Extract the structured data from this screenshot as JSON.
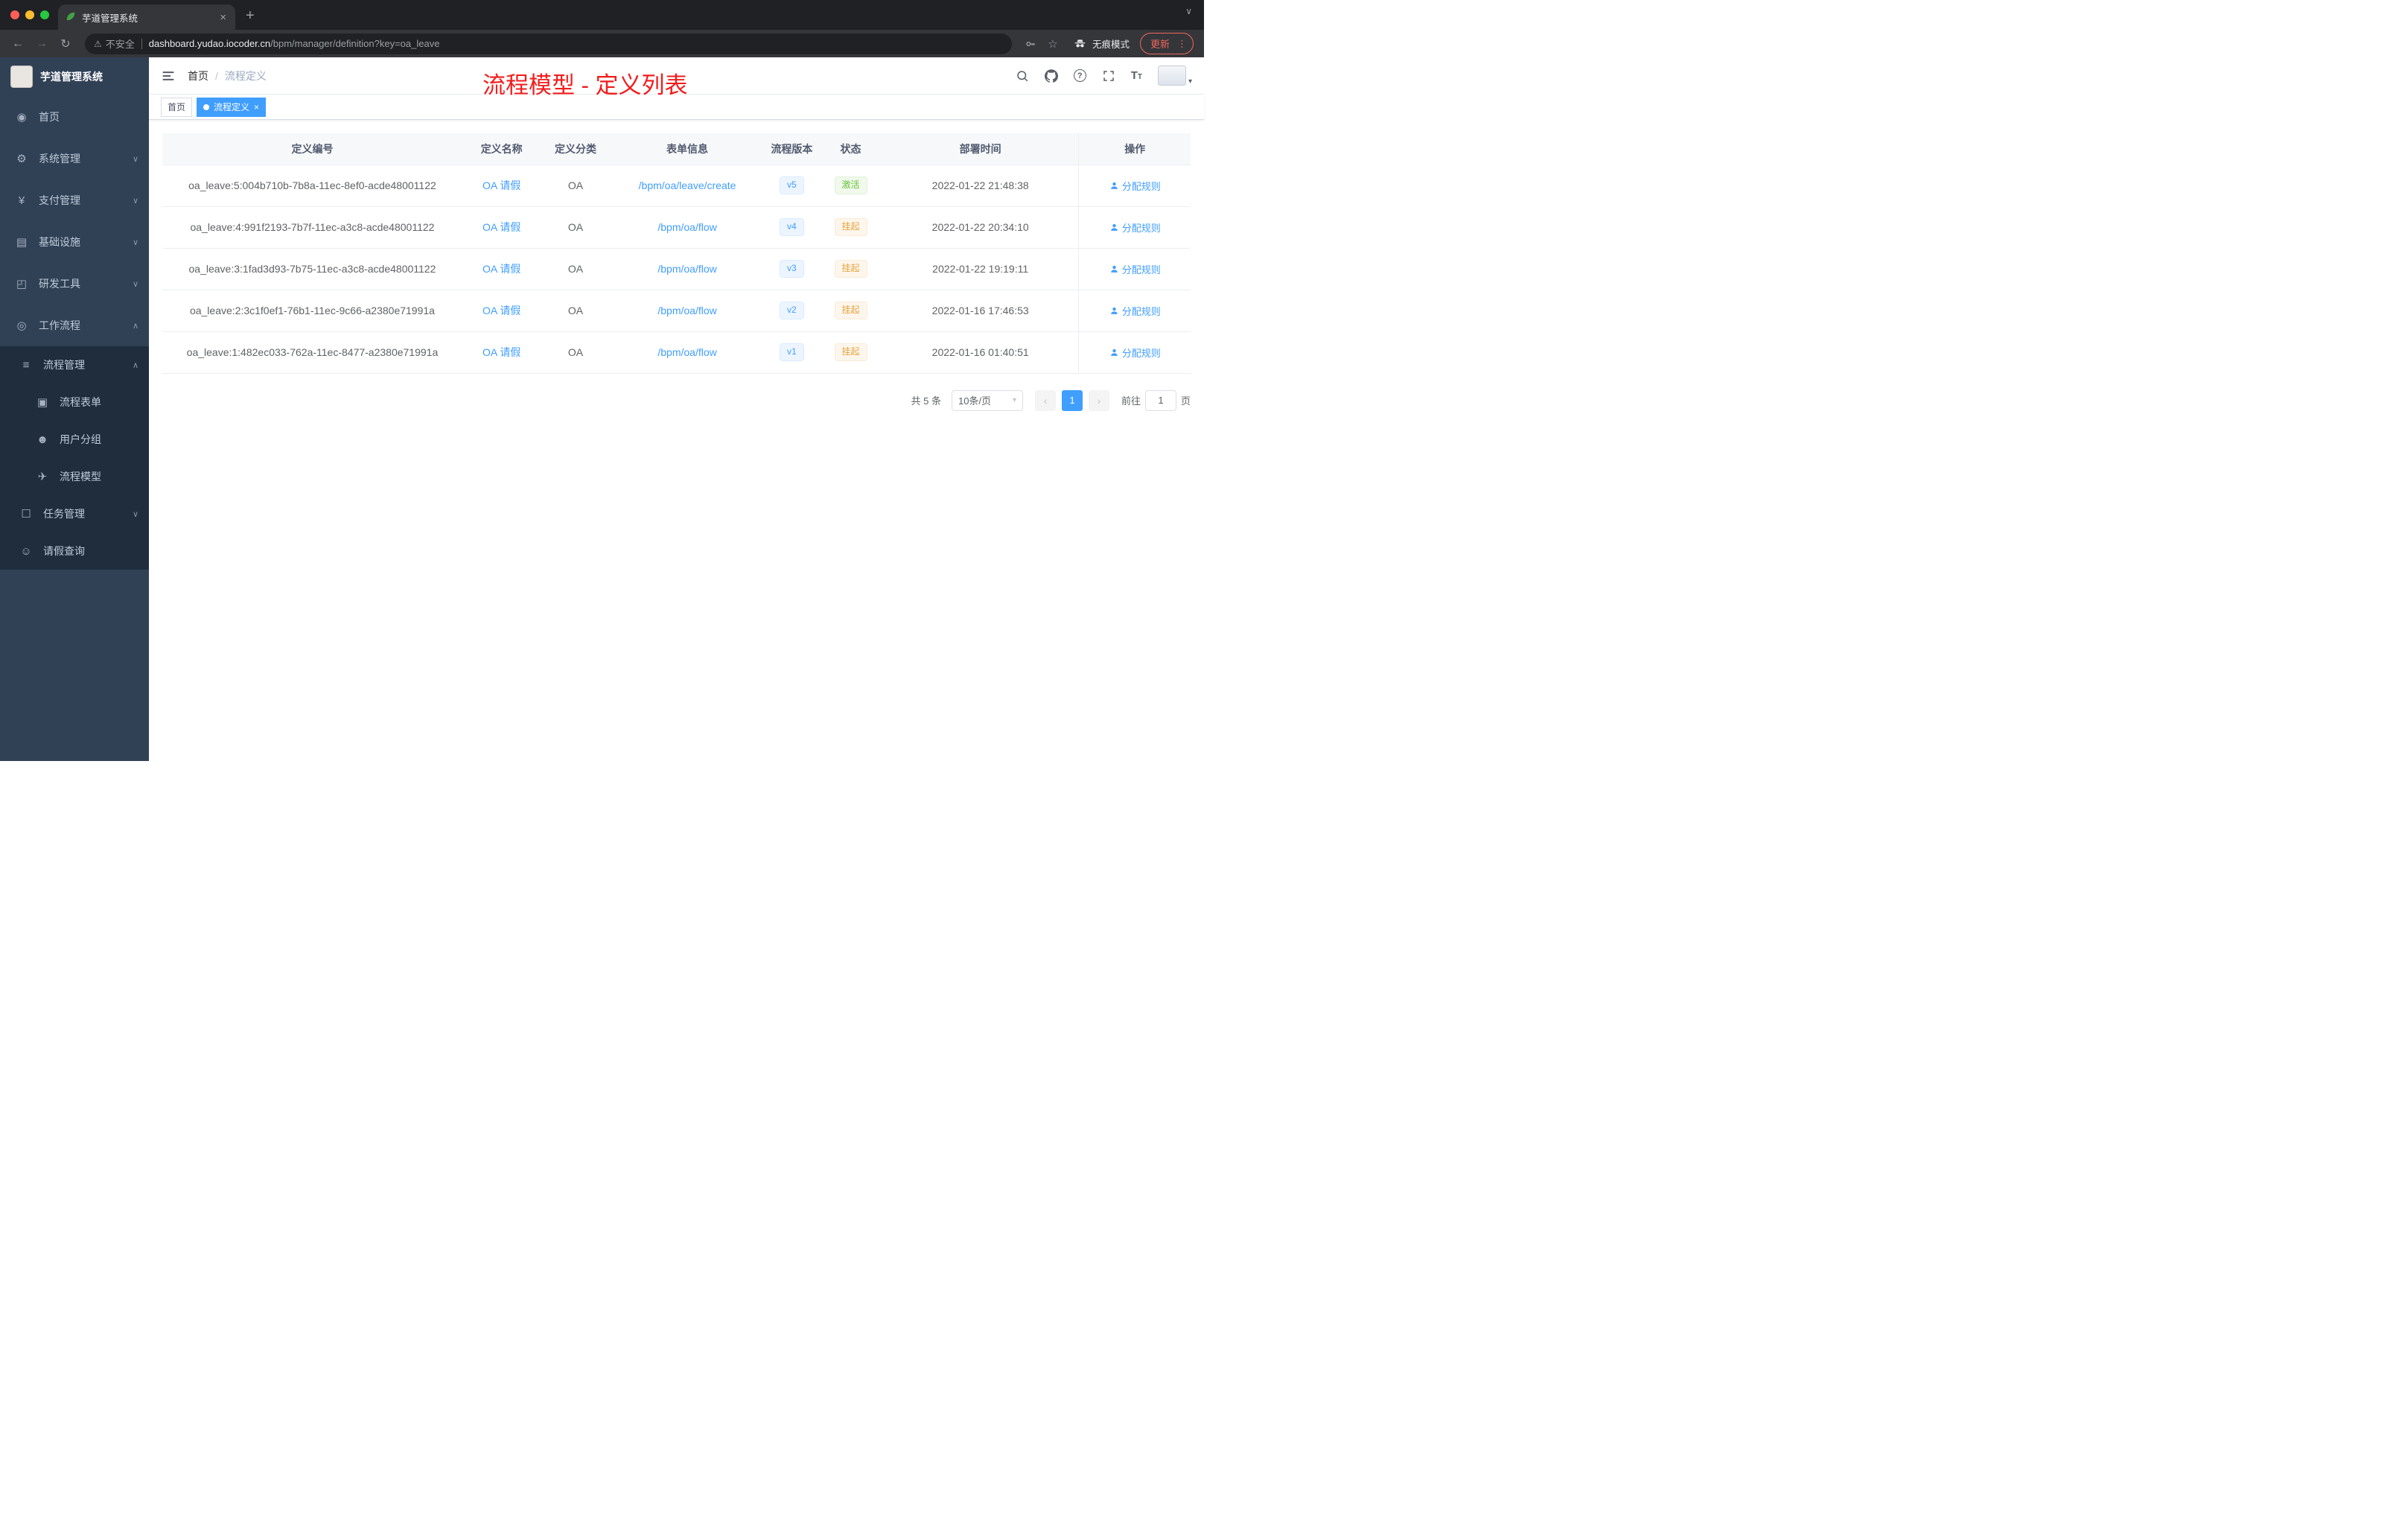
{
  "colors": {
    "accent": "#409eff",
    "annotation_red": "#f21c1c",
    "success": "#67c23a",
    "warning": "#e6a23c",
    "sidebar_bg": "#304156",
    "submenu_bg": "#1f2d3d"
  },
  "icons": {
    "back": "←",
    "forward": "→",
    "reload": "↻",
    "warning": "⚠",
    "star": "☆",
    "more": "⋮",
    "new_tab": "+",
    "close": "×",
    "chevron_down": "∨",
    "chevron_up": "∧",
    "caret_down": "▾",
    "prev": "‹",
    "next": "›",
    "help": "?",
    "t_large": "T",
    "t_small": "T"
  },
  "browser": {
    "tab_title": "芋道管理系统",
    "security": "不安全",
    "url_host": "dashboard.yudao.iocoder.cn",
    "url_path": "/bpm/manager/definition?key=oa_leave",
    "incognito": "无痕模式",
    "update": "更新"
  },
  "sidebar": {
    "title": "芋道管理系统",
    "items": [
      {
        "label": "首页",
        "glyph": "◉"
      },
      {
        "label": "系统管理",
        "glyph": "⚙"
      },
      {
        "label": "支付管理",
        "glyph": "¥"
      },
      {
        "label": "基础设施",
        "glyph": "▤"
      },
      {
        "label": "研发工具",
        "glyph": "◰"
      },
      {
        "label": "工作流程",
        "glyph": "◎"
      }
    ],
    "sub": {
      "process": {
        "label": "流程管理",
        "glyph": "≡"
      },
      "children": [
        {
          "label": "流程表单",
          "glyph": "▣"
        },
        {
          "label": "用户分组",
          "glyph": "☻"
        },
        {
          "label": "流程模型",
          "glyph": "✈"
        }
      ],
      "task": {
        "label": "任务管理",
        "glyph": "☐"
      },
      "leave": {
        "label": "请假查询",
        "glyph": "☺"
      }
    }
  },
  "topbar": {
    "breadcrumb": {
      "home": "首页",
      "sep": "/",
      "current": "流程定义"
    },
    "annotation": "流程模型 - 定义列表"
  },
  "tags": {
    "home": "首页",
    "active": "流程定义"
  },
  "table": {
    "headers": [
      "定义编号",
      "定义名称",
      "定义分类",
      "表单信息",
      "流程版本",
      "状态",
      "部署时间",
      "操作"
    ],
    "rows": [
      {
        "id": "oa_leave:5:004b710b-7b8a-11ec-8ef0-acde48001122",
        "name": "OA 请假",
        "category": "OA",
        "form": "/bpm/oa/leave/create",
        "version": "v5",
        "status": "激活",
        "time": "2022-01-22 21:48:38",
        "action": "分配规则"
      },
      {
        "id": "oa_leave:4:991f2193-7b7f-11ec-a3c8-acde48001122",
        "name": "OA 请假",
        "category": "OA",
        "form": "/bpm/oa/flow",
        "version": "v4",
        "status": "挂起",
        "time": "2022-01-22 20:34:10",
        "action": "分配规则"
      },
      {
        "id": "oa_leave:3:1fad3d93-7b75-11ec-a3c8-acde48001122",
        "name": "OA 请假",
        "category": "OA",
        "form": "/bpm/oa/flow",
        "version": "v3",
        "status": "挂起",
        "time": "2022-01-22 19:19:11",
        "action": "分配规则"
      },
      {
        "id": "oa_leave:2:3c1f0ef1-76b1-11ec-9c66-a2380e71991a",
        "name": "OA 请假",
        "category": "OA",
        "form": "/bpm/oa/flow",
        "version": "v2",
        "status": "挂起",
        "time": "2022-01-16 17:46:53",
        "action": "分配规则"
      },
      {
        "id": "oa_leave:1:482ec033-762a-11ec-8477-a2380e71991a",
        "name": "OA 请假",
        "category": "OA",
        "form": "/bpm/oa/flow",
        "version": "v1",
        "status": "挂起",
        "time": "2022-01-16 01:40:51",
        "action": "分配规则"
      }
    ]
  },
  "pagination": {
    "total": "共 5 条",
    "page_size": "10条/页",
    "page": "1",
    "goto_prefix": "前往",
    "goto_value": "1",
    "goto_suffix": "页"
  }
}
